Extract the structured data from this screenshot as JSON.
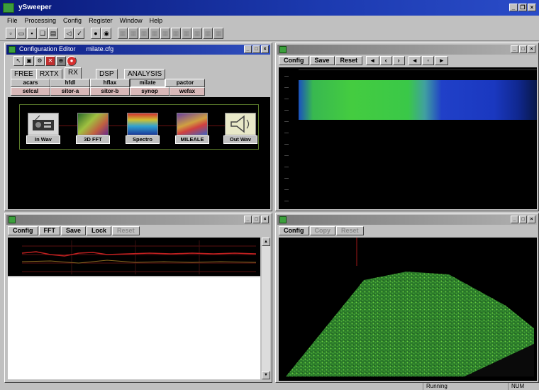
{
  "app": {
    "title": "ySweeper"
  },
  "menu": [
    "File",
    "Processing",
    "Config",
    "Register",
    "Window",
    "Help"
  ],
  "windows": {
    "config": {
      "title": "Configuration Editor",
      "file": "milate.cfg",
      "file_tabs": [
        "FREE",
        "RXTX",
        "RX",
        "DSP",
        "ANALYSIS"
      ],
      "selected_tab": "RX",
      "modes_row1": [
        "acars",
        "hfdl",
        "hflax",
        "milate",
        "pactor"
      ],
      "modes_row2": [
        "selcal",
        "sitor-a",
        "sitor-b",
        "synop",
        "wefax"
      ],
      "selected_mode": "milate",
      "modules": [
        "In Wav",
        "3D FFT",
        "Spectro",
        "MILEALE",
        "Out Wav"
      ]
    },
    "spectrogram": {
      "tabs": [
        "Config",
        "Save",
        "Reset"
      ]
    },
    "fft": {
      "tabs": [
        "Config",
        "FFT",
        "Save",
        "Lock",
        "Reset"
      ]
    },
    "waterfall3d": {
      "tabs": [
        "Config",
        "Copy",
        "Reset"
      ]
    }
  },
  "status": {
    "state": "Running",
    "mode": "NUM"
  },
  "colors": {
    "titlebar": "#0c1c80",
    "spectro_green": "#3ad048",
    "spectro_blue": "#1838c8",
    "fft_trace": "#c02020"
  }
}
